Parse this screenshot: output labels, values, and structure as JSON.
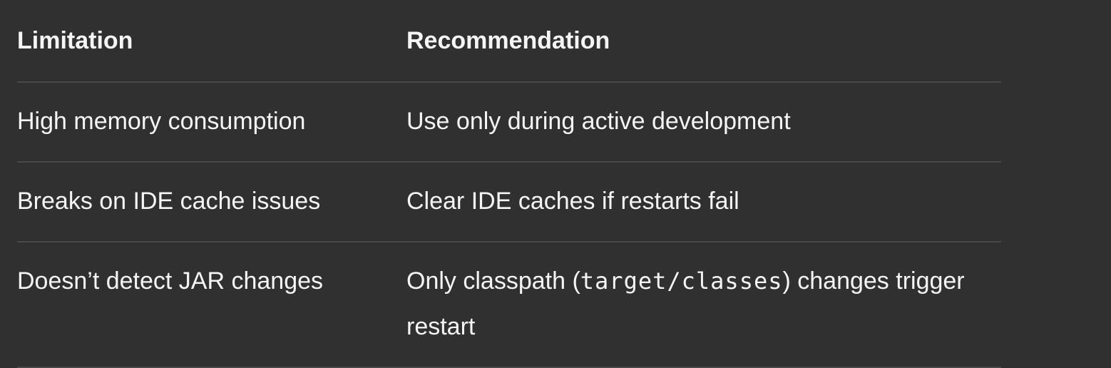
{
  "table": {
    "headers": [
      "Limitation",
      "Recommendation"
    ],
    "rows": [
      {
        "limitation": "High memory consumption",
        "recommendation": "Use only during active development"
      },
      {
        "limitation": "Breaks on IDE cache issues",
        "recommendation": "Clear IDE caches if restarts fail"
      },
      {
        "limitation": "Doesn’t detect JAR changes",
        "rec_before": "Only classpath (",
        "rec_code": "target/classes",
        "rec_after": ") changes trigger restart"
      }
    ]
  }
}
